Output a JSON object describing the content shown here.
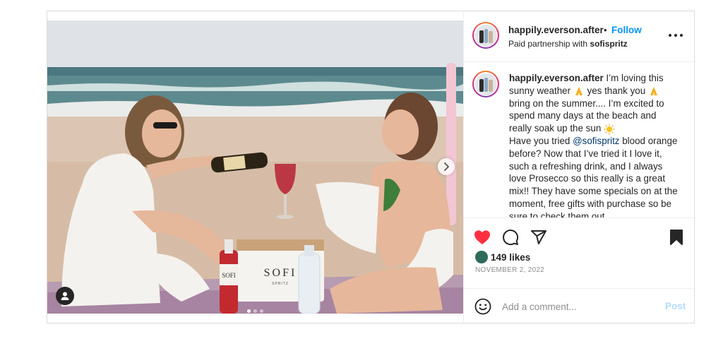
{
  "post": {
    "author": {
      "username": "happily.everson.after",
      "separator": "•",
      "follow_label": "Follow",
      "partnership_prefix": "Paid partnership with",
      "partner": "sofispritz"
    },
    "media": {
      "slides_total": 3,
      "slide_active": 1,
      "next_icon": "chevron-right-icon",
      "tag_icon": "user-tag-icon",
      "product_label": "SOFI",
      "product_sublabel": "SPRITZ",
      "bottle_label": "SOFI"
    },
    "caption": {
      "username": "happily.everson.after",
      "line1": " I’m loving this sunny weather ",
      "line2": " yes thank you ",
      "line3": " bring on the summer.... I’m excited to spend many days at the beach and really soak up the sun ",
      "line4_prefix": "Have you tried ",
      "mention": "@sofispritz",
      "line4_suffix": " blood orange before? Now that I’ve tried it I love it, such a refreshing drink, and I always love Prosecco so this really is a great mix!! They have some specials on at the moment, free gifts with purchase so be sure to check them out"
    },
    "actions": {
      "like_icon": "heart-icon",
      "comment_icon": "comment-icon",
      "share_icon": "share-icon",
      "save_icon": "bookmark-icon",
      "liked": true,
      "like_color": "#ff3040"
    },
    "likes": {
      "text": "149 likes"
    },
    "date": "NOVEMBER 2, 2022",
    "comment": {
      "placeholder": "Add a comment...",
      "post_label": "Post"
    },
    "colors": {
      "follow": "#0095f6",
      "post_disabled": "#b3dbff",
      "mention": "#00376b"
    }
  }
}
